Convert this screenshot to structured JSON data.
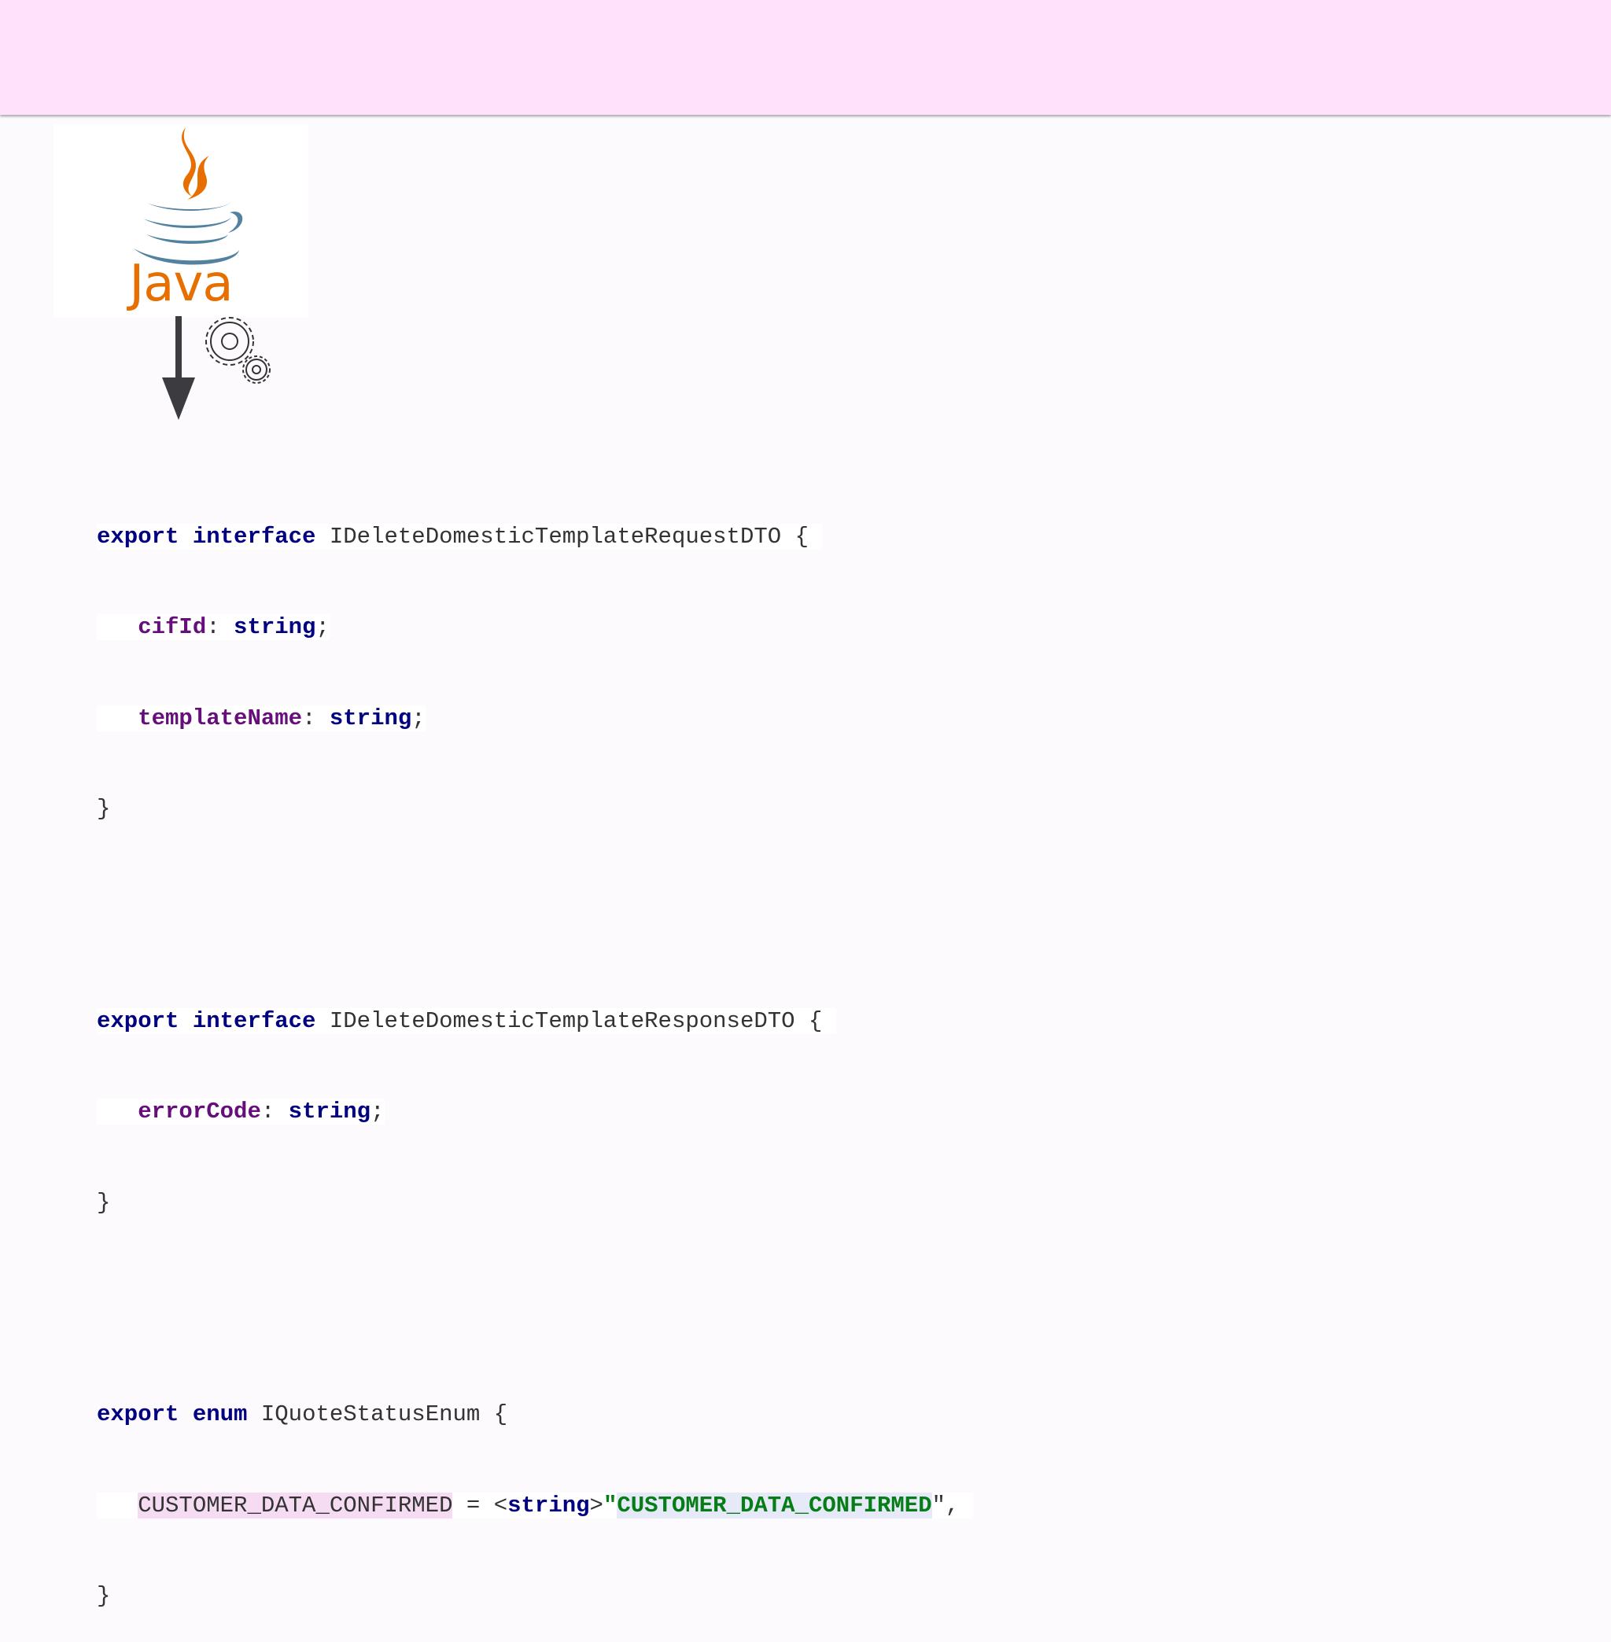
{
  "logo": {
    "text": "Java"
  },
  "colors": {
    "header_band": "#ffe1fc",
    "keyword": "#000080",
    "property": "#660e7a",
    "string": "#067d17",
    "java_orange": "#e76f00",
    "java_blue": "#5382a1"
  },
  "icons": {
    "arrow": "down-arrow-icon",
    "gears": "gears-icon"
  },
  "code": {
    "block1": {
      "kw_export": "export",
      "kw_interface": "interface",
      "name": "IDeleteDomesticTemplateRequestDTO",
      "open": " {",
      "fields": [
        {
          "name": "cifId",
          "colon": ": ",
          "type": "string",
          "end": ";"
        },
        {
          "name": "templateName",
          "colon": ": ",
          "type": "string",
          "end": ";"
        }
      ],
      "close": "}"
    },
    "block2": {
      "kw_export": "export",
      "kw_interface": "interface",
      "name": "IDeleteDomesticTemplateResponseDTO",
      "open": " {",
      "fields": [
        {
          "name": "errorCode",
          "colon": ": ",
          "type": "string",
          "end": ";"
        }
      ],
      "close": "}"
    },
    "block3": {
      "kw_export": "export",
      "kw_enum": "enum",
      "name": "IQuoteStatusEnum",
      "open": " {",
      "member": "CUSTOMER_DATA_CONFIRMED",
      "assign": " = <",
      "cast_type": "string",
      "cast_close": ">",
      "quote_open": "\"",
      "value": "CUSTOMER_DATA_CONFIRMED",
      "quote_close": "\",",
      "close": "}"
    }
  }
}
